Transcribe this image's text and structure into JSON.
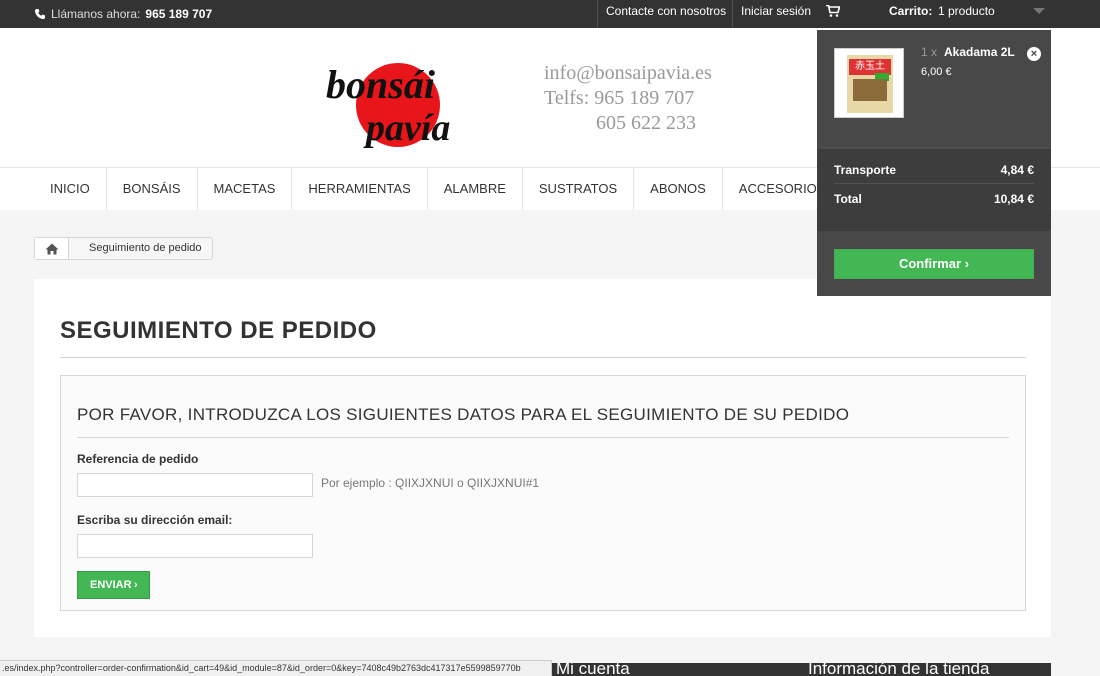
{
  "topbar": {
    "phone_prefix": "Llámanos ahora:",
    "phone_number": "965 189 707",
    "contact_link": "Contacte con nosotros",
    "login_link": "Iniciar sesión",
    "cart_label": "Carrito:",
    "cart_count": "1 producto"
  },
  "header": {
    "logo_line1": "bonsái",
    "logo_line2": "pavía",
    "email": "info@bonsaipavia.es",
    "phones_line1": "Telfs: 965 189 707",
    "phones_line2": "605 622 233"
  },
  "menu": {
    "items": [
      "Inicio",
      "Bonsáis",
      "Macetas",
      "Herramientas",
      "Alambre",
      "Sustratos",
      "Abonos",
      "Accesorios"
    ]
  },
  "breadcrumb": {
    "current": "Seguimiento de pedido"
  },
  "main": {
    "page_title": "Seguimiento de pedido",
    "box_title": "Por favor, introduzca los siguientes datos para el seguimiento de su pedido",
    "order_ref_label": "Referencia de pedido",
    "order_ref_value": "",
    "order_ref_hint": "Por ejemplo : QIIXJXNUI o QIIXJXNUI#1",
    "email_label": "Escriba su dirección email:",
    "email_value": "",
    "submit_label": "Enviar"
  },
  "cart_dropdown": {
    "item_qty": "1 x",
    "item_name": "Akadama 2L",
    "item_price": "6,00 €",
    "shipping_label": "Transporte",
    "shipping_value": "4,84 €",
    "total_label": "Total",
    "total_value": "10,84 €",
    "confirm_label": "Confirmar"
  },
  "footer": {
    "col1_title": "Mi cuenta",
    "col2_title": "Información de la tienda"
  },
  "status_url": ".es/index.php?controller=order-confirmation&id_cart=49&id_module=87&id_order=0&key=7408c49b2763dc417317e5599859770b",
  "colors": {
    "accent_green": "#43b754",
    "topbar_bg": "#333333",
    "cart_dropdown_bg": "#484848",
    "logo_red": "#e8151b"
  }
}
